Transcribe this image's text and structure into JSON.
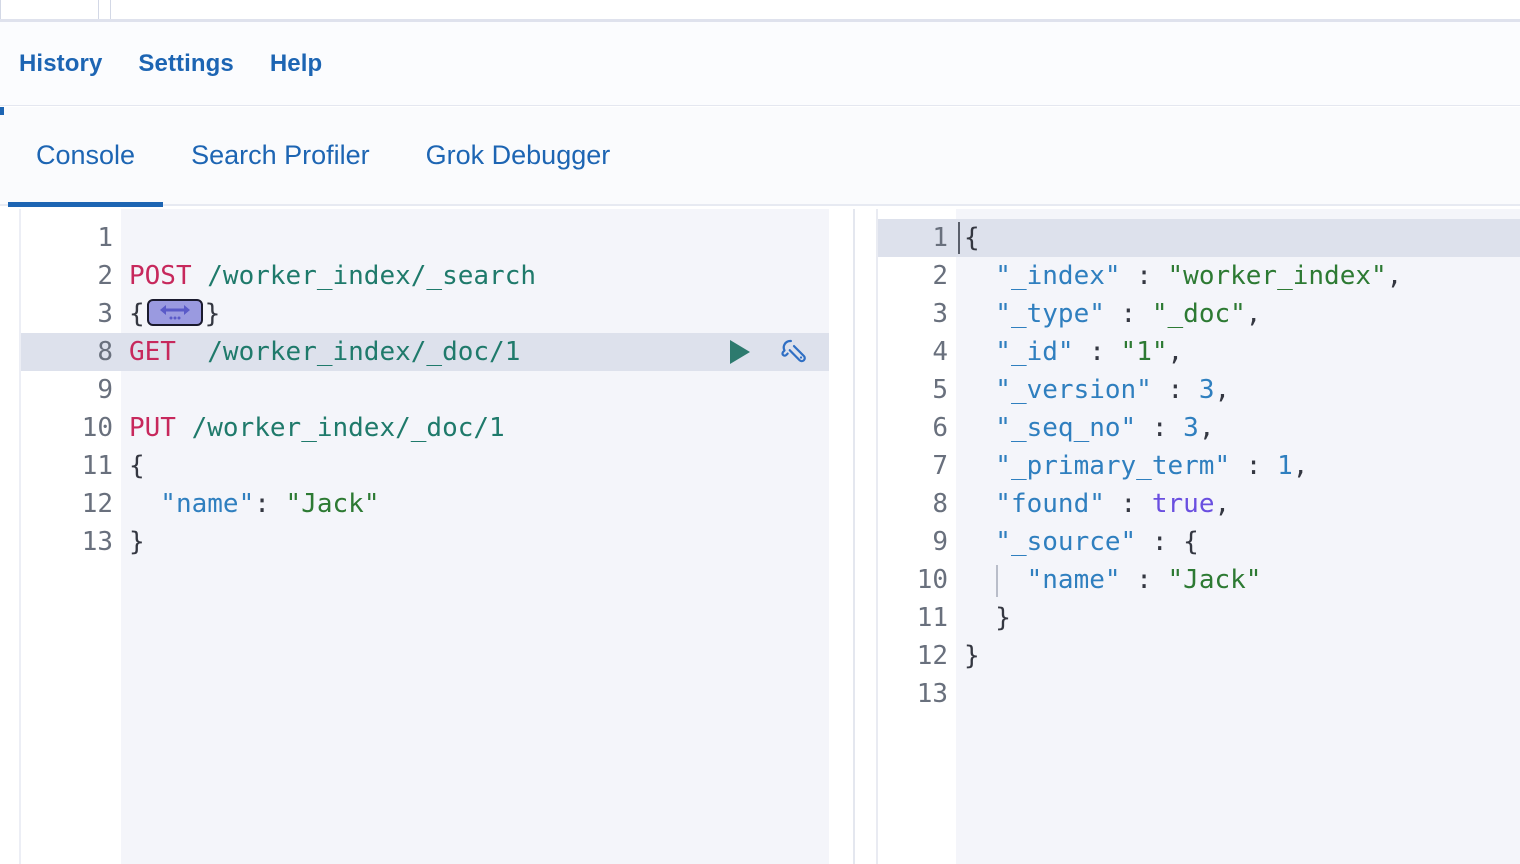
{
  "menu": {
    "items": [
      {
        "label": "History",
        "name": "menu-item-history"
      },
      {
        "label": "Settings",
        "name": "menu-item-settings"
      },
      {
        "label": "Help",
        "name": "menu-item-help"
      }
    ]
  },
  "tabs": {
    "items": [
      {
        "label": "Console",
        "active": true
      },
      {
        "label": "Search Profiler",
        "active": false
      },
      {
        "label": "Grok Debugger",
        "active": false
      }
    ],
    "active_index": 0
  },
  "colors": {
    "accent": "#1d65b3",
    "method": "#c7285c",
    "url": "#1f7a6b",
    "key": "#2f7fbf",
    "string": "#2d7a33",
    "boolean": "#6a4fe0",
    "editor_bg": "#f4f5fa",
    "gutter_bg": "#ffffff",
    "active_line_bg": "#dde1ec",
    "fold_pill_bg": "#9a9ae0",
    "play_icon": "#2d7a6e"
  },
  "request_editor": {
    "name": "request-editor",
    "lines": [
      {
        "num": "1",
        "fold": "",
        "active": false,
        "tokens": []
      },
      {
        "num": "2",
        "fold": "",
        "active": false,
        "tokens": [
          {
            "t": "POST",
            "c": "tok-method"
          },
          {
            "t": " /worker_index/_search",
            "c": "tok-url"
          }
        ]
      },
      {
        "num": "3",
        "fold": "collapsed",
        "active": false,
        "tokens": [
          {
            "t": "{",
            "c": "tok-punct"
          },
          {
            "t": "FOLD_PILL",
            "c": "fold-widget"
          },
          {
            "t": "}",
            "c": "tok-punct"
          }
        ]
      },
      {
        "num": "8",
        "fold": "",
        "active": true,
        "tokens": [
          {
            "t": "GET",
            "c": "tok-method"
          },
          {
            "t": "  /worker_index/_doc/1",
            "c": "tok-url"
          }
        ]
      },
      {
        "num": "9",
        "fold": "",
        "active": false,
        "tokens": []
      },
      {
        "num": "10",
        "fold": "",
        "active": false,
        "tokens": [
          {
            "t": "PUT",
            "c": "tok-method"
          },
          {
            "t": " /worker_index/_doc/1",
            "c": "tok-url"
          }
        ]
      },
      {
        "num": "11",
        "fold": "open",
        "active": false,
        "tokens": [
          {
            "t": "{",
            "c": "tok-punct"
          }
        ]
      },
      {
        "num": "12",
        "fold": "",
        "active": false,
        "tokens": [
          {
            "t": "  \"name\"",
            "c": "tok-key"
          },
          {
            "t": ": ",
            "c": "tok-punct"
          },
          {
            "t": "\"Jack\"",
            "c": "tok-str"
          }
        ]
      },
      {
        "num": "13",
        "fold": "close",
        "active": false,
        "tokens": [
          {
            "t": "}",
            "c": "tok-punct"
          }
        ]
      }
    ],
    "actions": {
      "play_label": "Click to send request",
      "wrench_label": "Open documentation / options",
      "play_icon": "play-icon",
      "wrench_icon": "wrench-icon"
    }
  },
  "response_editor": {
    "name": "response-editor",
    "lines": [
      {
        "num": "1",
        "fold": "open",
        "active": true,
        "tokens": [
          {
            "t": "{",
            "c": "tok-punct"
          }
        ]
      },
      {
        "num": "2",
        "fold": "",
        "active": false,
        "tokens": [
          {
            "t": "  \"_index\"",
            "c": "tok-key"
          },
          {
            "t": " : ",
            "c": "tok-punct"
          },
          {
            "t": "\"worker_index\"",
            "c": "tok-str"
          },
          {
            "t": ",",
            "c": "tok-punct"
          }
        ]
      },
      {
        "num": "3",
        "fold": "",
        "active": false,
        "tokens": [
          {
            "t": "  \"_type\"",
            "c": "tok-key"
          },
          {
            "t": " : ",
            "c": "tok-punct"
          },
          {
            "t": "\"_doc\"",
            "c": "tok-str"
          },
          {
            "t": ",",
            "c": "tok-punct"
          }
        ]
      },
      {
        "num": "4",
        "fold": "",
        "active": false,
        "tokens": [
          {
            "t": "  \"_id\"",
            "c": "tok-key"
          },
          {
            "t": " : ",
            "c": "tok-punct"
          },
          {
            "t": "\"1\"",
            "c": "tok-str"
          },
          {
            "t": ",",
            "c": "tok-punct"
          }
        ]
      },
      {
        "num": "5",
        "fold": "",
        "active": false,
        "tokens": [
          {
            "t": "  \"_version\"",
            "c": "tok-key"
          },
          {
            "t": " : ",
            "c": "tok-punct"
          },
          {
            "t": "3",
            "c": "tok-num"
          },
          {
            "t": ",",
            "c": "tok-punct"
          }
        ]
      },
      {
        "num": "6",
        "fold": "",
        "active": false,
        "tokens": [
          {
            "t": "  \"_seq_no\"",
            "c": "tok-key"
          },
          {
            "t": " : ",
            "c": "tok-punct"
          },
          {
            "t": "3",
            "c": "tok-num"
          },
          {
            "t": ",",
            "c": "tok-punct"
          }
        ]
      },
      {
        "num": "7",
        "fold": "",
        "active": false,
        "tokens": [
          {
            "t": "  \"_primary_term\"",
            "c": "tok-key"
          },
          {
            "t": " : ",
            "c": "tok-punct"
          },
          {
            "t": "1",
            "c": "tok-num"
          },
          {
            "t": ",",
            "c": "tok-punct"
          }
        ]
      },
      {
        "num": "8",
        "fold": "",
        "active": false,
        "tokens": [
          {
            "t": "  \"found\"",
            "c": "tok-key"
          },
          {
            "t": " : ",
            "c": "tok-punct"
          },
          {
            "t": "true",
            "c": "tok-bool"
          },
          {
            "t": ",",
            "c": "tok-punct"
          }
        ]
      },
      {
        "num": "9",
        "fold": "open",
        "active": false,
        "tokens": [
          {
            "t": "  \"_source\"",
            "c": "tok-key"
          },
          {
            "t": " : ",
            "c": "tok-punct"
          },
          {
            "t": "{",
            "c": "tok-punct"
          }
        ]
      },
      {
        "num": "10",
        "fold": "",
        "active": false,
        "indent_guide": true,
        "tokens": [
          {
            "t": "    \"name\"",
            "c": "tok-key"
          },
          {
            "t": " : ",
            "c": "tok-punct"
          },
          {
            "t": "\"Jack\"",
            "c": "tok-str"
          }
        ]
      },
      {
        "num": "11",
        "fold": "close",
        "active": false,
        "tokens": [
          {
            "t": "  }",
            "c": "tok-punct"
          }
        ]
      },
      {
        "num": "12",
        "fold": "close",
        "active": false,
        "tokens": [
          {
            "t": "}",
            "c": "tok-punct"
          }
        ]
      },
      {
        "num": "13",
        "fold": "",
        "active": false,
        "tokens": []
      }
    ]
  }
}
